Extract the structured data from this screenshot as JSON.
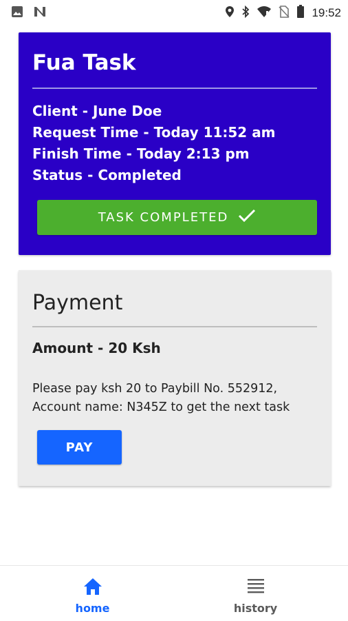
{
  "status_bar": {
    "time": "19:52",
    "icons": [
      "image-icon",
      "n-app-icon",
      "location-icon",
      "bluetooth-icon",
      "wifi-icon",
      "no-sim-icon",
      "battery-icon"
    ]
  },
  "task_card": {
    "title": "Fua Task",
    "client": "Client - June Doe",
    "request_time": "Request Time - Today 11:52 am",
    "finish_time": "Finish Time - Today 2:13 pm",
    "status": "Status - Completed",
    "button_label": "TASK COMPLETED",
    "button_icon": "checkmark-icon",
    "colors": {
      "background": "#2a00c6",
      "button": "#4caf2e"
    }
  },
  "payment_card": {
    "title": "Payment",
    "amount": "Amount - 20 Ksh",
    "message": "Please pay ksh 20 to Paybill No. 552912, Account name: N345Z to get the next task",
    "pay_button": "PAY",
    "colors": {
      "background": "#ececec",
      "button": "#1565ff"
    }
  },
  "bottom_nav": {
    "items": [
      {
        "label": "home",
        "icon": "home-icon",
        "active": true,
        "color": "#1565ff"
      },
      {
        "label": "history",
        "icon": "list-icon",
        "active": false,
        "color": "#5a5a5a"
      }
    ]
  }
}
